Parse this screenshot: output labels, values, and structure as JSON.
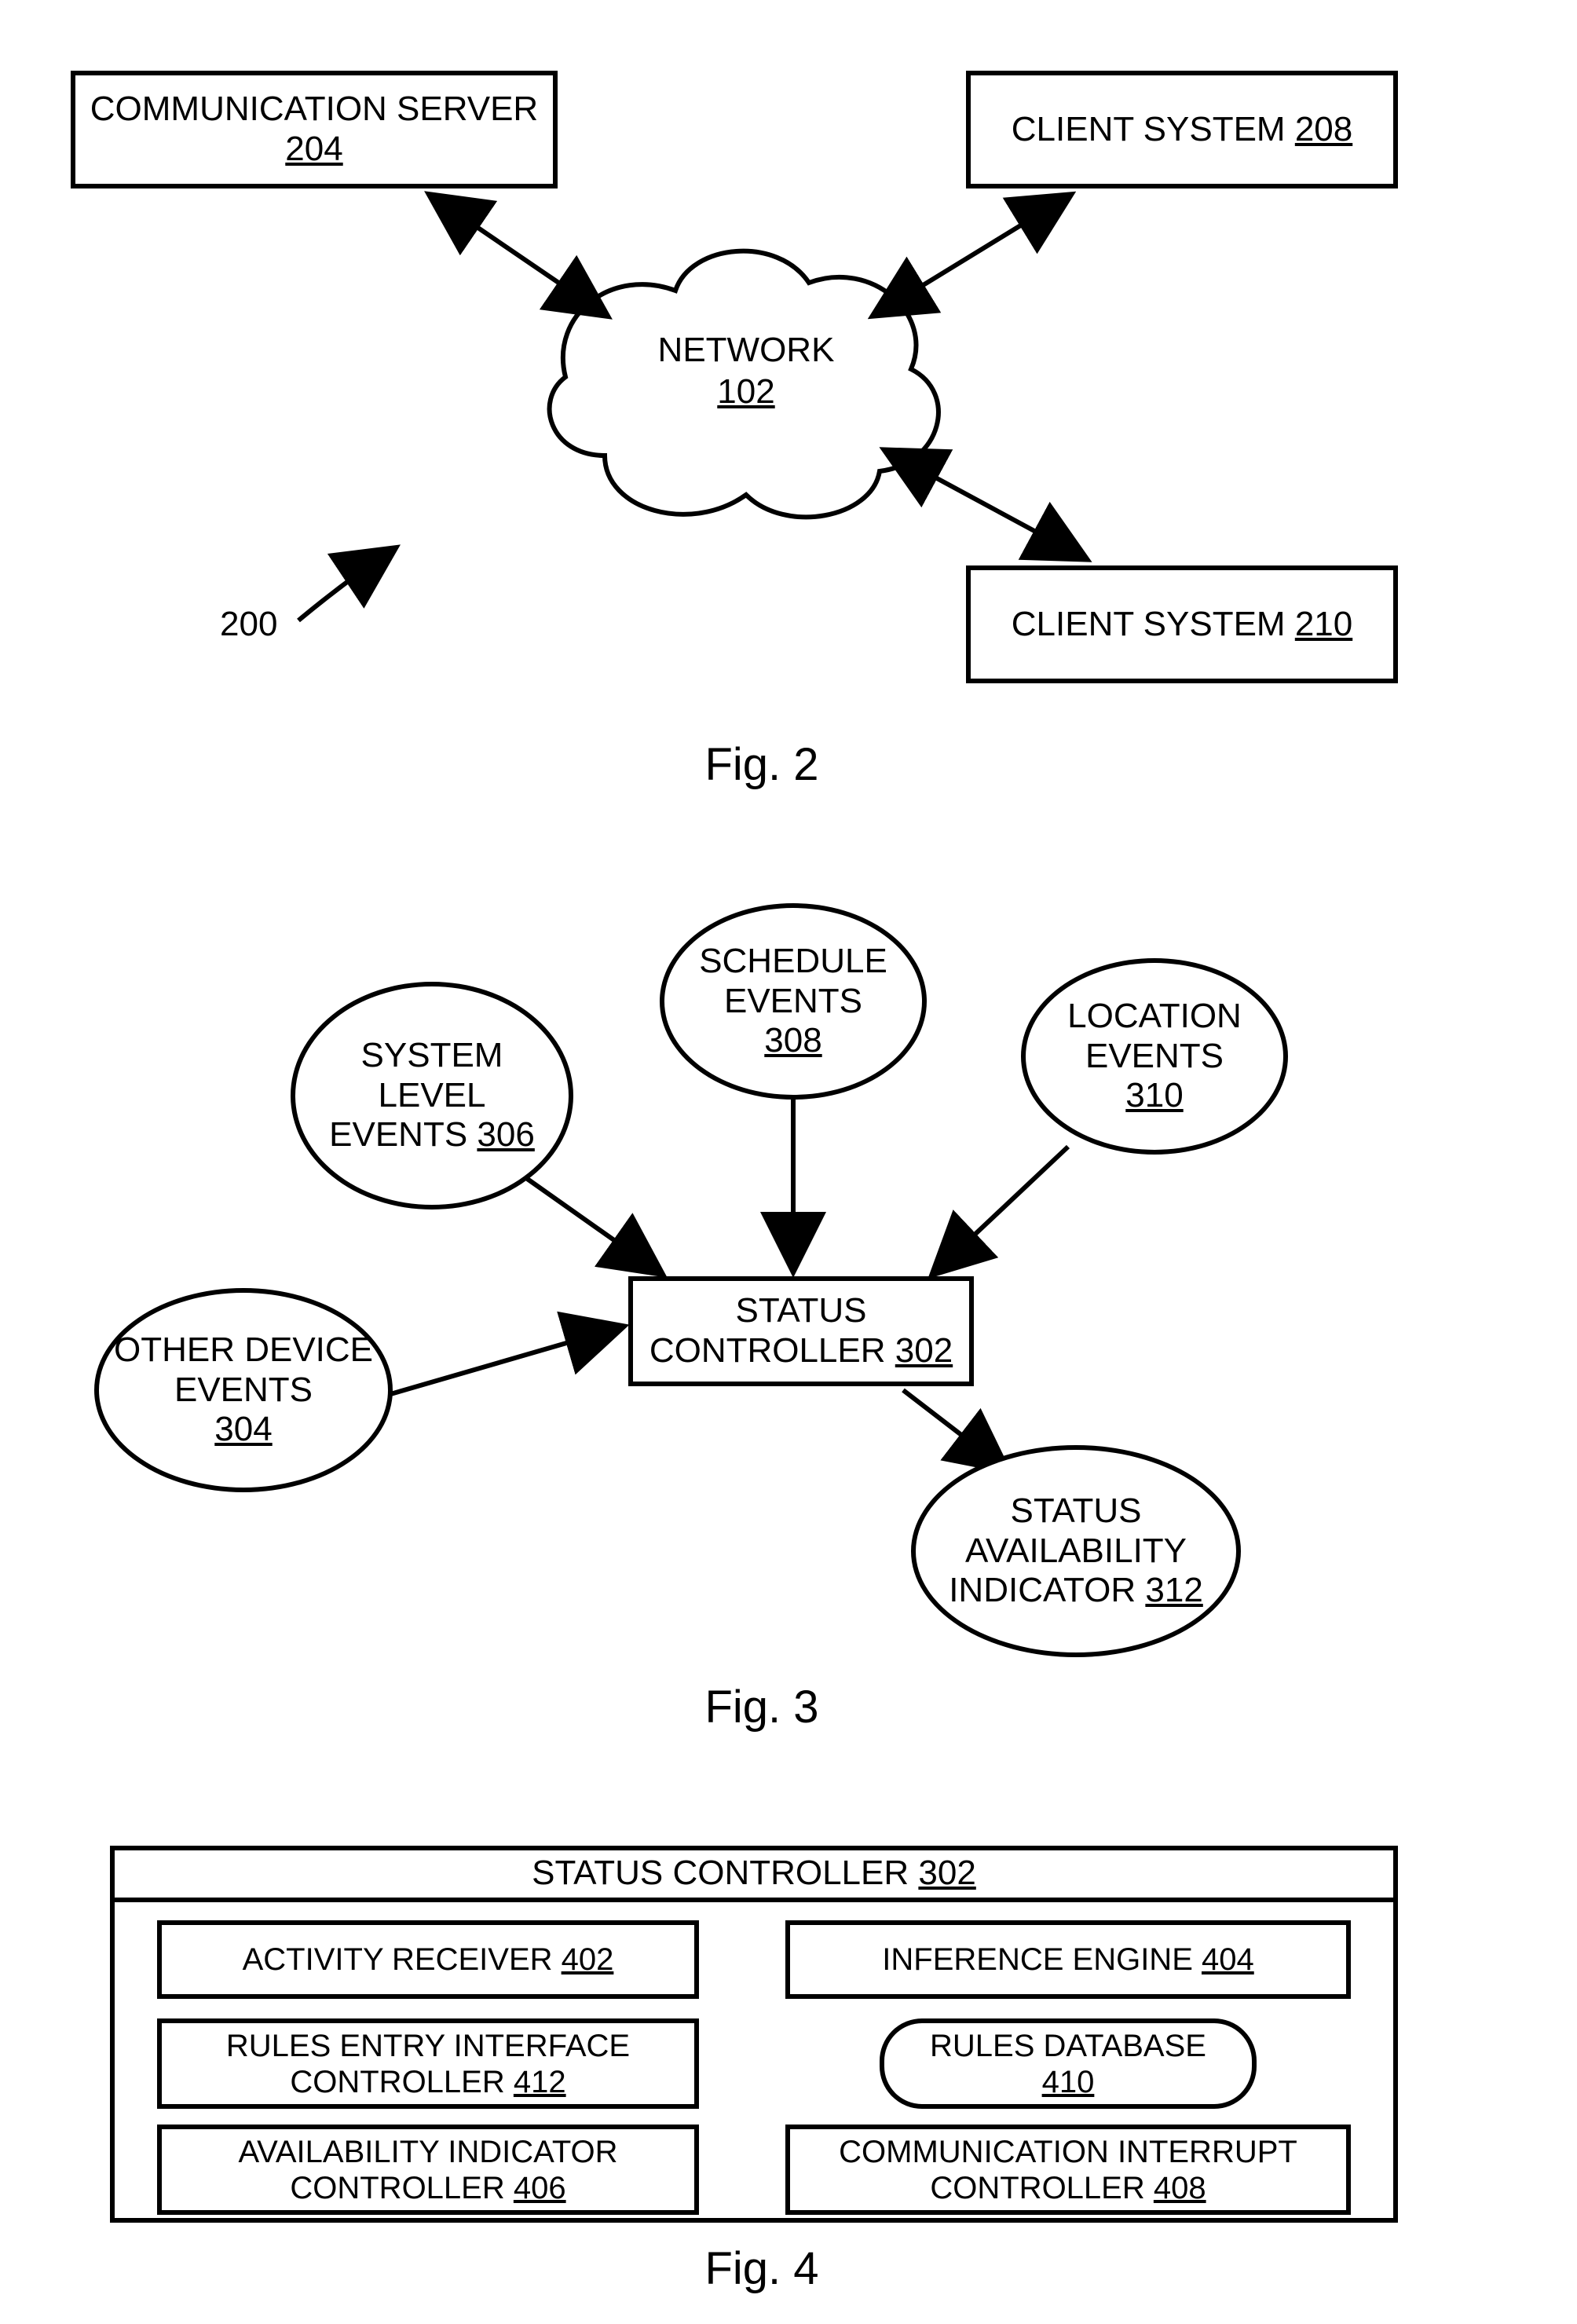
{
  "fig2": {
    "caption": "Fig. 2",
    "ref_num": "200",
    "comm_server": {
      "label": "COMMUNICATION SERVER ",
      "num": "204"
    },
    "network": {
      "label": "NETWORK",
      "num": "102"
    },
    "client1": {
      "label": "CLIENT SYSTEM ",
      "num": "208"
    },
    "client2": {
      "label": "CLIENT SYSTEM ",
      "num": "210"
    }
  },
  "fig3": {
    "caption": "Fig. 3",
    "other_device": {
      "line1": "OTHER DEVICE",
      "line2": "EVENTS",
      "num": "304"
    },
    "system_level": {
      "line1": "SYSTEM",
      "line2": "LEVEL",
      "line3": "EVENTS ",
      "num": "306"
    },
    "schedule": {
      "line1": "SCHEDULE",
      "line2": "EVENTS",
      "num": "308"
    },
    "location": {
      "line1": "LOCATION",
      "line2": "EVENTS",
      "num": "310"
    },
    "status_controller": {
      "line1": "STATUS",
      "line2": "CONTROLLER ",
      "num": "302"
    },
    "status_indicator": {
      "line1": "STATUS",
      "line2": "AVAILABILITY",
      "line3": "INDICATOR ",
      "num": "312"
    }
  },
  "fig4": {
    "caption": "Fig. 4",
    "title": {
      "label": "STATUS CONTROLLER ",
      "num": "302"
    },
    "activity_receiver": {
      "label": "ACTIVITY RECEIVER ",
      "num": "402"
    },
    "inference_engine": {
      "label": "INFERENCE ENGINE ",
      "num": "404"
    },
    "rules_entry": {
      "line1": "RULES ENTRY INTERFACE",
      "line2": "CONTROLLER ",
      "num": "412"
    },
    "rules_db": {
      "line1": "RULES DATABASE",
      "num": "410"
    },
    "avail_indicator": {
      "line1": "AVAILABILITY INDICATOR",
      "line2": "CONTROLLER ",
      "num": "406"
    },
    "comm_interrupt": {
      "line1": "COMMUNICATION INTERRUPT",
      "line2": "CONTROLLER ",
      "num": "408"
    }
  }
}
